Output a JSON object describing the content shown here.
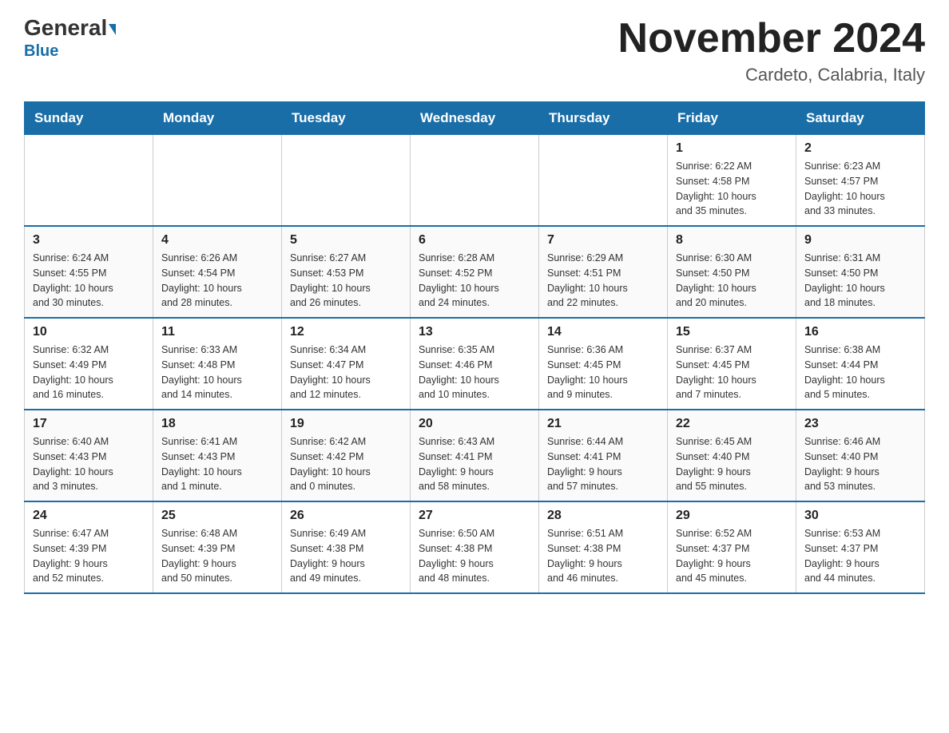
{
  "header": {
    "logo_general": "General",
    "logo_blue": "Blue",
    "month_title": "November 2024",
    "subtitle": "Cardeto, Calabria, Italy"
  },
  "days_of_week": [
    "Sunday",
    "Monday",
    "Tuesday",
    "Wednesday",
    "Thursday",
    "Friday",
    "Saturday"
  ],
  "weeks": [
    [
      {
        "day": "",
        "info": ""
      },
      {
        "day": "",
        "info": ""
      },
      {
        "day": "",
        "info": ""
      },
      {
        "day": "",
        "info": ""
      },
      {
        "day": "",
        "info": ""
      },
      {
        "day": "1",
        "info": "Sunrise: 6:22 AM\nSunset: 4:58 PM\nDaylight: 10 hours\nand 35 minutes."
      },
      {
        "day": "2",
        "info": "Sunrise: 6:23 AM\nSunset: 4:57 PM\nDaylight: 10 hours\nand 33 minutes."
      }
    ],
    [
      {
        "day": "3",
        "info": "Sunrise: 6:24 AM\nSunset: 4:55 PM\nDaylight: 10 hours\nand 30 minutes."
      },
      {
        "day": "4",
        "info": "Sunrise: 6:26 AM\nSunset: 4:54 PM\nDaylight: 10 hours\nand 28 minutes."
      },
      {
        "day": "5",
        "info": "Sunrise: 6:27 AM\nSunset: 4:53 PM\nDaylight: 10 hours\nand 26 minutes."
      },
      {
        "day": "6",
        "info": "Sunrise: 6:28 AM\nSunset: 4:52 PM\nDaylight: 10 hours\nand 24 minutes."
      },
      {
        "day": "7",
        "info": "Sunrise: 6:29 AM\nSunset: 4:51 PM\nDaylight: 10 hours\nand 22 minutes."
      },
      {
        "day": "8",
        "info": "Sunrise: 6:30 AM\nSunset: 4:50 PM\nDaylight: 10 hours\nand 20 minutes."
      },
      {
        "day": "9",
        "info": "Sunrise: 6:31 AM\nSunset: 4:50 PM\nDaylight: 10 hours\nand 18 minutes."
      }
    ],
    [
      {
        "day": "10",
        "info": "Sunrise: 6:32 AM\nSunset: 4:49 PM\nDaylight: 10 hours\nand 16 minutes."
      },
      {
        "day": "11",
        "info": "Sunrise: 6:33 AM\nSunset: 4:48 PM\nDaylight: 10 hours\nand 14 minutes."
      },
      {
        "day": "12",
        "info": "Sunrise: 6:34 AM\nSunset: 4:47 PM\nDaylight: 10 hours\nand 12 minutes."
      },
      {
        "day": "13",
        "info": "Sunrise: 6:35 AM\nSunset: 4:46 PM\nDaylight: 10 hours\nand 10 minutes."
      },
      {
        "day": "14",
        "info": "Sunrise: 6:36 AM\nSunset: 4:45 PM\nDaylight: 10 hours\nand 9 minutes."
      },
      {
        "day": "15",
        "info": "Sunrise: 6:37 AM\nSunset: 4:45 PM\nDaylight: 10 hours\nand 7 minutes."
      },
      {
        "day": "16",
        "info": "Sunrise: 6:38 AM\nSunset: 4:44 PM\nDaylight: 10 hours\nand 5 minutes."
      }
    ],
    [
      {
        "day": "17",
        "info": "Sunrise: 6:40 AM\nSunset: 4:43 PM\nDaylight: 10 hours\nand 3 minutes."
      },
      {
        "day": "18",
        "info": "Sunrise: 6:41 AM\nSunset: 4:43 PM\nDaylight: 10 hours\nand 1 minute."
      },
      {
        "day": "19",
        "info": "Sunrise: 6:42 AM\nSunset: 4:42 PM\nDaylight: 10 hours\nand 0 minutes."
      },
      {
        "day": "20",
        "info": "Sunrise: 6:43 AM\nSunset: 4:41 PM\nDaylight: 9 hours\nand 58 minutes."
      },
      {
        "day": "21",
        "info": "Sunrise: 6:44 AM\nSunset: 4:41 PM\nDaylight: 9 hours\nand 57 minutes."
      },
      {
        "day": "22",
        "info": "Sunrise: 6:45 AM\nSunset: 4:40 PM\nDaylight: 9 hours\nand 55 minutes."
      },
      {
        "day": "23",
        "info": "Sunrise: 6:46 AM\nSunset: 4:40 PM\nDaylight: 9 hours\nand 53 minutes."
      }
    ],
    [
      {
        "day": "24",
        "info": "Sunrise: 6:47 AM\nSunset: 4:39 PM\nDaylight: 9 hours\nand 52 minutes."
      },
      {
        "day": "25",
        "info": "Sunrise: 6:48 AM\nSunset: 4:39 PM\nDaylight: 9 hours\nand 50 minutes."
      },
      {
        "day": "26",
        "info": "Sunrise: 6:49 AM\nSunset: 4:38 PM\nDaylight: 9 hours\nand 49 minutes."
      },
      {
        "day": "27",
        "info": "Sunrise: 6:50 AM\nSunset: 4:38 PM\nDaylight: 9 hours\nand 48 minutes."
      },
      {
        "day": "28",
        "info": "Sunrise: 6:51 AM\nSunset: 4:38 PM\nDaylight: 9 hours\nand 46 minutes."
      },
      {
        "day": "29",
        "info": "Sunrise: 6:52 AM\nSunset: 4:37 PM\nDaylight: 9 hours\nand 45 minutes."
      },
      {
        "day": "30",
        "info": "Sunrise: 6:53 AM\nSunset: 4:37 PM\nDaylight: 9 hours\nand 44 minutes."
      }
    ]
  ]
}
